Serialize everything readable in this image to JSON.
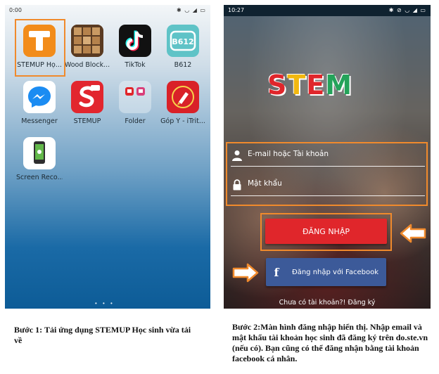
{
  "left_phone": {
    "status_time": "0:00",
    "status_icons": "✱ ◡ ◢ ▭",
    "apps": [
      {
        "label": "STEMUP Họ...",
        "icon": "stemup-t-icon"
      },
      {
        "label": "Wood Block...",
        "icon": "wood-block-icon"
      },
      {
        "label": "TikTok",
        "icon": "tiktok-icon"
      },
      {
        "label": "B612",
        "icon": "b612-icon"
      },
      {
        "label": "Messenger",
        "icon": "messenger-icon"
      },
      {
        "label": "STEMUP",
        "icon": "stemup-red-icon"
      },
      {
        "label": "Folder",
        "icon": "folder-icon"
      },
      {
        "label": "Góp Ý - iTrit...",
        "icon": "gop-y-icon"
      },
      {
        "label": "Screen Reco...",
        "icon": "screen-recorder-icon"
      }
    ],
    "dots": "• • •"
  },
  "right_phone": {
    "status_time": "10:27",
    "status_icons": "✱ ⊘ ◡ ◢ ▭",
    "logo_letters": [
      "S",
      "T",
      "E",
      "M"
    ],
    "email_placeholder": "E-mail hoặc Tài khoản",
    "password_placeholder": "Mật khẩu",
    "login_label": "ĐĂNG NHẬP",
    "facebook_label": "Đăng nhập với Facebook",
    "register_text": "Chưa có tài khoản?! Đăng ký"
  },
  "captions": {
    "step1": "Bước 1: Tải ứng dụng STEMUP Học sinh vừa tải về",
    "step2": "Bước 2:Màn hình đăng nhập hiển thị. Nhập email và mật khẩu tài khoản học sinh đã đăng ký trên do.ste.vn (nếu có). Bạn cũng có thể đăng nhận bằng tài khoản facebook cá nhân."
  },
  "colors": {
    "highlight": "#f08a2c",
    "login_red": "#e0262b",
    "facebook_blue": "#3c5a99"
  }
}
